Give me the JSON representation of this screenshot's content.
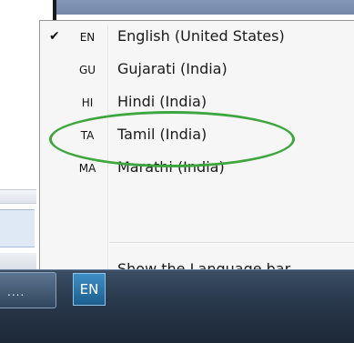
{
  "menu": {
    "items": [
      {
        "checked": true,
        "check_glyph": "✔",
        "code": "EN",
        "label": "English (United States)"
      },
      {
        "checked": false,
        "code": "GU",
        "label": "Gujarati (India)"
      },
      {
        "checked": false,
        "code": "HI",
        "label": "Hindi (India)",
        "highlighted": true
      },
      {
        "checked": false,
        "code": "TA",
        "label": "Tamil (India)"
      },
      {
        "checked": false,
        "code": "MA",
        "label": "Marathi (India)"
      }
    ],
    "show_language_bar": {
      "accel": "S",
      "rest": "how the Language bar"
    }
  },
  "taskbar": {
    "task_button_label": "....",
    "language_button_label": "EN"
  },
  "colors": {
    "highlight_ring": "#3ea63e",
    "menu_background": "#f6f6f6",
    "taskbar": "#2a3a4d"
  }
}
